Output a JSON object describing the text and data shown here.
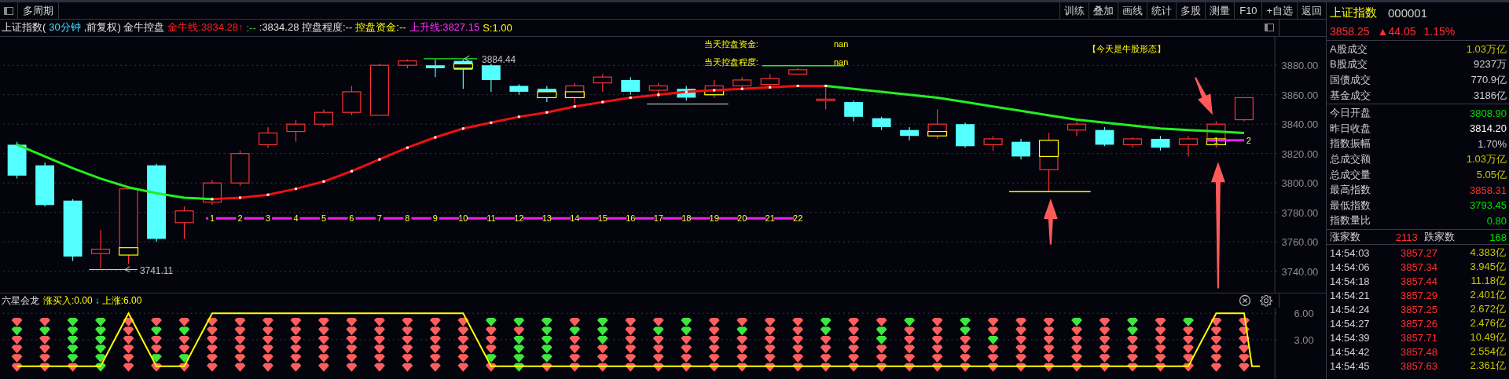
{
  "toolbar": {
    "tabs": [
      {
        "label": "多周期"
      }
    ],
    "buttons": [
      "训练",
      "叠加",
      "画线",
      "统计",
      "多股",
      "测量",
      "F10",
      "+自选",
      "返回"
    ]
  },
  "info_line": [
    {
      "text": "上证指数(",
      "kind": "plain"
    },
    {
      "text": "30分钟",
      "kind": "period"
    },
    {
      "text": ",前复权) 金牛控盘",
      "kind": "plain"
    },
    {
      "text": "金牛线:3834.28↑",
      "kind": "rising"
    },
    {
      "text": ":--",
      "kind": "falling"
    },
    {
      "text": ":3834.28 控盘程度:--",
      "kind": "plain"
    },
    {
      "text": "控盘资金:--",
      "kind": "signal"
    },
    {
      "text": "上升线:3827.15",
      "kind": "trend"
    },
    {
      "text": "S:1.00",
      "kind": "signal"
    }
  ],
  "chart": {
    "y_axis": [
      "3880.00",
      "3860.00",
      "3840.00",
      "3820.00",
      "3800.00",
      "3780.00",
      "3760.00",
      "3740.00"
    ],
    "notes": [
      {
        "label": "当天控盘资金:",
        "value": "nan"
      },
      {
        "label": "当天控盘程度:",
        "value": "nan"
      }
    ],
    "pattern_note": "【今天是牛股形态】",
    "max_label": "3884.44",
    "min_label": "3741.11",
    "count_labels": [
      "1",
      "2",
      "3",
      "4",
      "5",
      "6",
      "7",
      "8",
      "9",
      "10",
      "11",
      "12",
      "13",
      "14",
      "15",
      "16",
      "17",
      "18",
      "19",
      "20",
      "21",
      "22"
    ],
    "recent_count_labels": [
      "1",
      "2"
    ]
  },
  "indicator": {
    "name": "六星会龙",
    "values": [
      {
        "text": "涨买入:0.00",
        "kind": "signal"
      },
      {
        "text": "↓",
        "kind": "period"
      },
      {
        "text": "上涨:6.00",
        "kind": "signal"
      }
    ],
    "y_axis": [
      "6.00",
      "3.00"
    ]
  },
  "quote": {
    "name": "上证指数",
    "code": "000001",
    "price": "3858.25",
    "change": "▲44.05",
    "percent": "1.15%"
  },
  "volume_stats": [
    {
      "label": "A股成交",
      "value": "1.03万亿",
      "color": "#c8c800"
    },
    {
      "label": "B股成交",
      "value": "9237万",
      "color": "#d0d0d0"
    },
    {
      "label": "国债成交",
      "value": "770.9亿",
      "color": "#d0d0d0"
    },
    {
      "label": "基金成交",
      "value": "3186亿",
      "color": "#d0d0d0"
    }
  ],
  "index_stats": [
    {
      "label": "今日开盘",
      "value": "3808.90",
      "color": "#00e000"
    },
    {
      "label": "昨日收盘",
      "value": "3814.20",
      "color": "#ffffff"
    },
    {
      "label": "指数振幅",
      "value": "1.70%",
      "color": "#d0d0d0"
    },
    {
      "label": "总成交额",
      "value": "1.03万亿",
      "color": "#c8c800"
    },
    {
      "label": "总成交量",
      "value": "5.05亿",
      "color": "#c8c800"
    },
    {
      "label": "最高指数",
      "value": "3858.31",
      "color": "#ff3030"
    },
    {
      "label": "最低指数",
      "value": "3793.45",
      "color": "#00e000"
    },
    {
      "label": "指数量比",
      "value": "0.80",
      "color": "#00e000"
    }
  ],
  "breadth": {
    "up_label": "涨家数",
    "up": "2113",
    "down_label": "跌家数",
    "down": "168"
  },
  "trades": [
    {
      "time": "14:54:03",
      "price": "3857.27",
      "amount": "4.383亿"
    },
    {
      "time": "14:54:06",
      "price": "3857.34",
      "amount": "3.945亿"
    },
    {
      "time": "14:54:18",
      "price": "3857.44",
      "amount": "11.18亿"
    },
    {
      "time": "14:54:21",
      "price": "3857.29",
      "amount": "2.401亿"
    },
    {
      "time": "14:54:24",
      "price": "3857.25",
      "amount": "2.672亿"
    },
    {
      "time": "14:54:27",
      "price": "3857.26",
      "amount": "2.476亿"
    },
    {
      "time": "14:54:39",
      "price": "3857.71",
      "amount": "10.49亿"
    },
    {
      "time": "14:54:42",
      "price": "3857.48",
      "amount": "2.554亿"
    },
    {
      "time": "14:54:45",
      "price": "3857.63",
      "amount": "2.361亿"
    }
  ]
}
